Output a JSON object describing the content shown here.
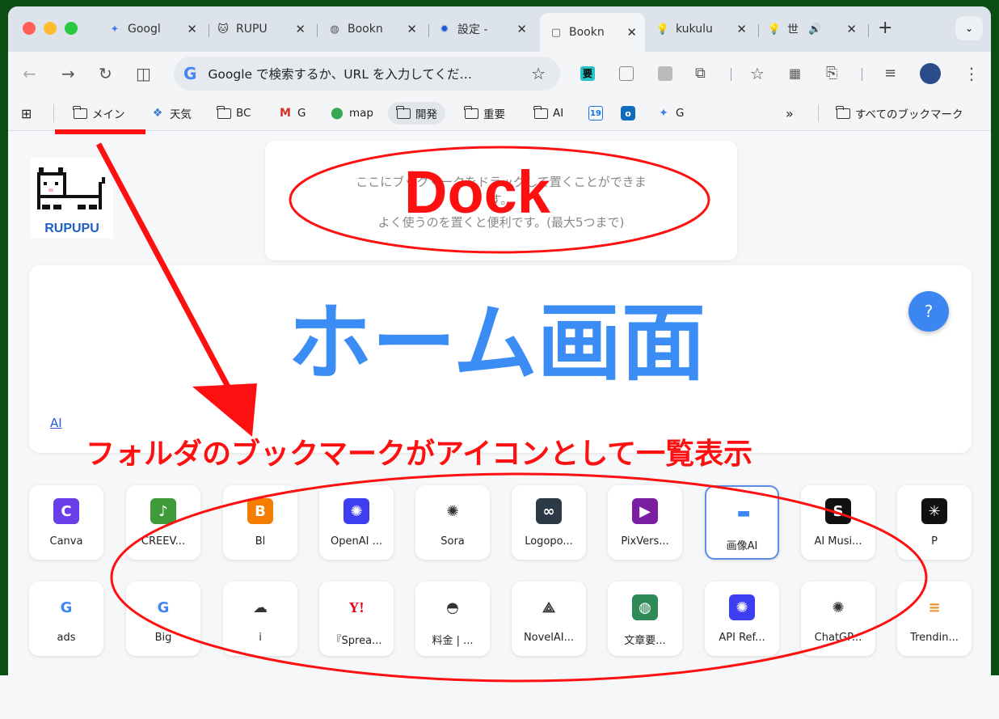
{
  "tabs": [
    {
      "label": "Googl",
      "icon": "gemini-icon"
    },
    {
      "label": "RUPU",
      "icon": "cat-icon"
    },
    {
      "label": "Bookn",
      "icon": "globe-icon"
    },
    {
      "label": "設定 -",
      "icon": "gear-icon"
    },
    {
      "label": "Bookn",
      "icon": "bookmark-page-icon"
    },
    {
      "label": "kukulu",
      "icon": "bulb-icon"
    },
    {
      "label": "世",
      "icon": "bulb-icon"
    }
  ],
  "new_tab": "+",
  "tab_menu": "⌄",
  "omnibox": {
    "g": "G",
    "text": "Google で検索するか、URL を入力してくだ…",
    "star": "☆"
  },
  "ext_yaku": "要",
  "bookmarks": [
    {
      "label": "メイン",
      "icon": "folder-icon"
    },
    {
      "label": "天気",
      "icon": "weather-icon"
    },
    {
      "label": "BC",
      "icon": "folder-icon"
    },
    {
      "label": "G",
      "icon": "gmail-icon"
    },
    {
      "label": "map",
      "icon": "maps-icon"
    },
    {
      "label": "開発",
      "icon": "folder-icon"
    },
    {
      "label": "重要",
      "icon": "folder-icon"
    },
    {
      "label": "AI",
      "icon": "folder-icon"
    },
    {
      "label": "G",
      "icon": "gemini-icon"
    }
  ],
  "calendar_day": "19",
  "bookmarks_more": "»",
  "all_bookmarks": "すべてのブックマーク",
  "logo_text": "RUPUPU",
  "dock": {
    "line1": "ここにブックマークをドラッグして置くことができま",
    "line2": "す。",
    "line3": "よく使うのを置くと便利です。(最大5つまで)"
  },
  "folder_link": "AI",
  "help": "?",
  "row1": [
    {
      "label": "Canva",
      "glyph": "C",
      "color": "#6a3ee8"
    },
    {
      "label": "CREEV...",
      "glyph": "♪",
      "color": "#3f9b3a"
    },
    {
      "label": "Bl",
      "glyph": "B",
      "color": "#f57d00"
    },
    {
      "label": "OpenAI ...",
      "glyph": "✺",
      "color": "#3d3df2"
    },
    {
      "label": "Sora",
      "glyph": "✺",
      "color": "#ffffff"
    },
    {
      "label": "Logopo...",
      "glyph": "∞",
      "color": "#2c3a47"
    },
    {
      "label": "PixVers...",
      "glyph": "▶",
      "color": "#7b1fa2"
    },
    {
      "label": "画像AI",
      "glyph": "▬",
      "color": "#ffffff"
    },
    {
      "label": "AI Musi...",
      "glyph": "S",
      "color": "#111111"
    },
    {
      "label": "P",
      "glyph": "✳",
      "color": "#111111"
    }
  ],
  "row2": [
    {
      "label": "ads",
      "glyph": "G",
      "color": "#ffffff"
    },
    {
      "label": "Big",
      "glyph": "G",
      "color": "#ffffff"
    },
    {
      "label": "i",
      "glyph": "☁",
      "color": "#ffffff"
    },
    {
      "label": "『Sprea...",
      "glyph": "Y!",
      "color": "#ffffff"
    },
    {
      "label": "料金 | ...",
      "glyph": "◓",
      "color": "#ffffff"
    },
    {
      "label": "NovelAI...",
      "glyph": "⟁",
      "color": "#ffffff"
    },
    {
      "label": "文章要...",
      "glyph": "◍",
      "color": "#2e8b57"
    },
    {
      "label": "API Ref...",
      "glyph": "✺",
      "color": "#3d3df2"
    },
    {
      "label": "ChatGP...",
      "glyph": "✺",
      "color": "#ffffff"
    },
    {
      "label": "Trendin...",
      "glyph": "≡",
      "color": "#ffffff"
    }
  ],
  "annotations": {
    "dock": "Dock",
    "home": "ホーム画面",
    "caption": "フォルダのブックマークがアイコンとして一覧表示"
  }
}
